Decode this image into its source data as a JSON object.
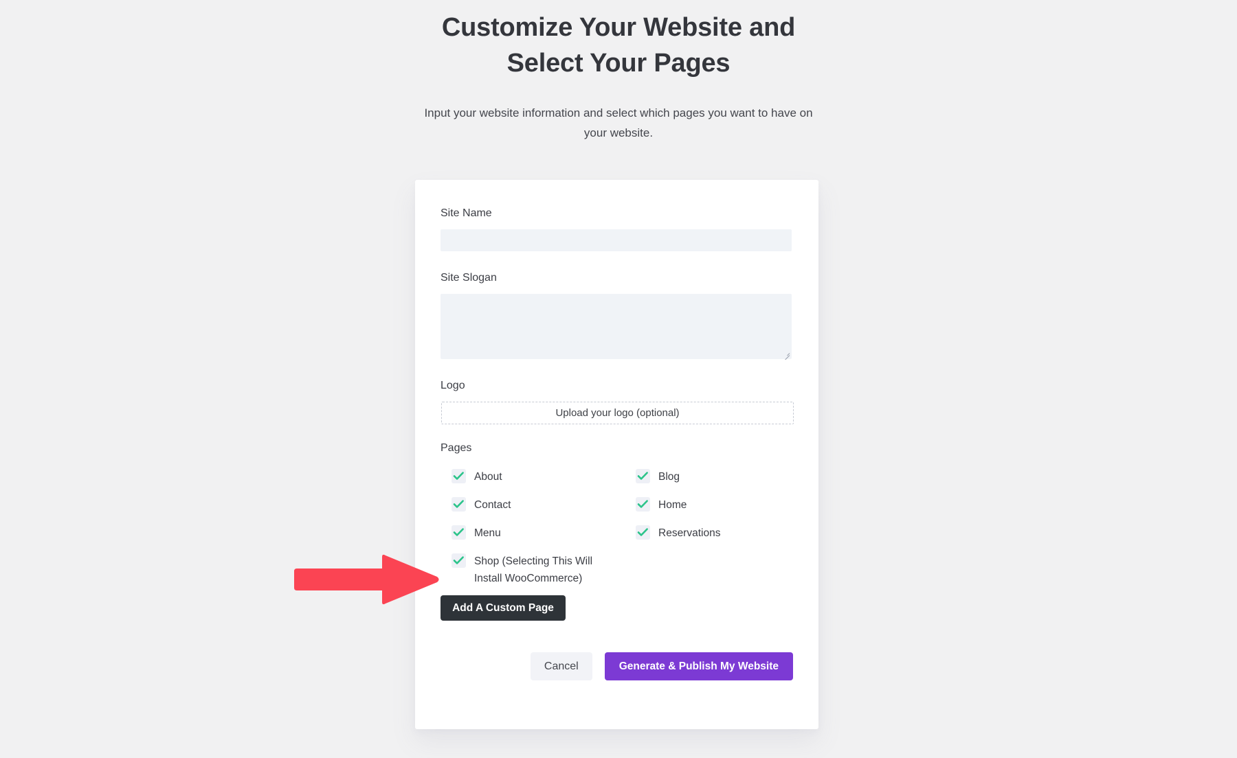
{
  "header": {
    "title": "Customize Your Website and Select Your Pages",
    "subtitle": "Input your website information and select which pages you want to have on your website."
  },
  "form": {
    "site_name": {
      "label": "Site Name",
      "value": "",
      "placeholder": ""
    },
    "site_slogan": {
      "label": "Site Slogan",
      "value": "",
      "placeholder": ""
    },
    "logo": {
      "label": "Logo",
      "upload_text": "Upload your logo (optional)"
    },
    "pages": {
      "label": "Pages",
      "options": [
        {
          "label": "About",
          "checked": true
        },
        {
          "label": "Blog",
          "checked": true
        },
        {
          "label": "Contact",
          "checked": true
        },
        {
          "label": "Home",
          "checked": true
        },
        {
          "label": "Menu",
          "checked": true
        },
        {
          "label": "Reservations",
          "checked": true
        },
        {
          "label": "Shop (Selecting This Will Install WooCommerce)",
          "checked": true
        }
      ]
    },
    "add_custom_page_label": "Add A Custom Page"
  },
  "actions": {
    "cancel_label": "Cancel",
    "publish_label": "Generate & Publish My Website"
  },
  "annotation": {
    "arrow": "red-right-arrow",
    "points_at": "Shop (Selecting This Will Install WooCommerce)"
  },
  "colors": {
    "page_background": "#f1f1f2",
    "card_background": "#ffffff",
    "heading_text": "#34363c",
    "body_text": "#44464d",
    "input_fill": "#f0f3f7",
    "checkbox_fill": "#eef0f6",
    "check_accent": "#2bc48a",
    "dark_button": "#2e3338",
    "primary_button": "#7c3ad4",
    "cancel_button": "#f2f3f7",
    "annotation_arrow": "#fb4453"
  }
}
